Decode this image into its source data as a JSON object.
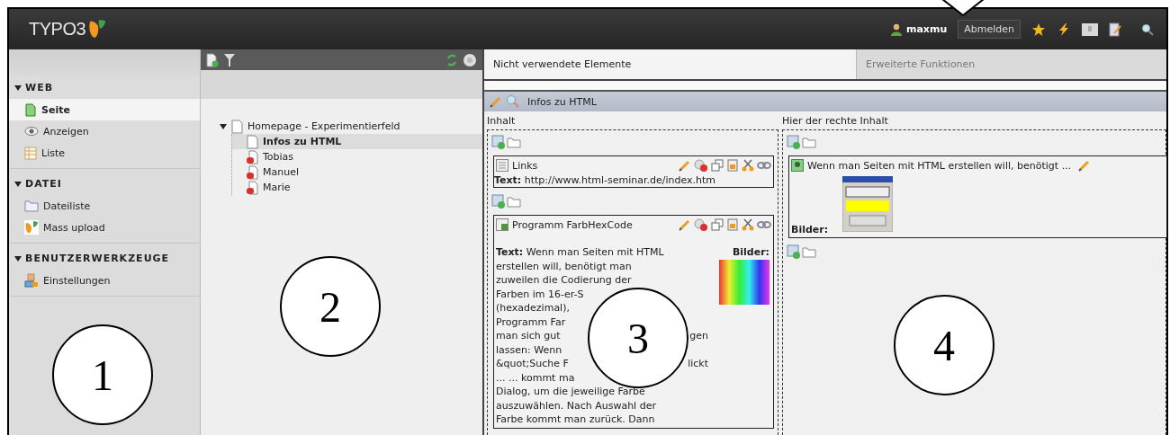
{
  "header": {
    "logo": "TYPO3",
    "user": "maxmu",
    "logout": "Abmelden"
  },
  "sidebar": {
    "groups": [
      {
        "title": "WEB",
        "expanded": true,
        "items": [
          {
            "label": "Seite",
            "kind": "page",
            "selected": true
          },
          {
            "label": "Anzeigen",
            "kind": "view",
            "selected": false
          },
          {
            "label": "Liste",
            "kind": "list",
            "selected": false
          }
        ]
      },
      {
        "title": "DATEI",
        "expanded": true,
        "items": [
          {
            "label": "Dateiliste",
            "kind": "files",
            "selected": false
          },
          {
            "label": "Mass upload",
            "kind": "logo",
            "selected": false
          }
        ]
      },
      {
        "title": "BENUTZERWERKZEUGE",
        "expanded": true,
        "items": [
          {
            "label": "Einstellungen",
            "kind": "settings",
            "selected": false
          }
        ]
      }
    ]
  },
  "page_tree": {
    "items": [
      {
        "label": "Homepage - Experimentierfeld",
        "kind": "page",
        "expanded": true,
        "selected": false,
        "children": [
          {
            "label": "Infos zu HTML",
            "kind": "page",
            "selected": true
          },
          {
            "label": "Tobias",
            "kind": "restricted",
            "selected": false
          },
          {
            "label": "Manuel",
            "kind": "restricted",
            "selected": false
          },
          {
            "label": "Marie",
            "kind": "restricted",
            "selected": false
          }
        ]
      }
    ]
  },
  "tabs": [
    {
      "label": "Nicht verwendete Elemente",
      "selected": true
    },
    {
      "label": "Erweiterte Funktionen",
      "selected": false
    }
  ],
  "page_header": {
    "title": "Infos zu HTML"
  },
  "columns": [
    {
      "heading": "Inhalt",
      "elements": [
        {
          "kind": "text",
          "title": "Links",
          "body": "**Text:** http://www.html-seminar.de/index.htm"
        },
        {
          "kind": "textpic",
          "title": "Programm FarbHexCode",
          "images_label": "Bilder:",
          "lines": [
            {
              "left": "**Text:** Wenn man Seiten mit HTML"
            },
            {
              "left": "erstellen will, benötigt man"
            },
            {
              "left": "zuweilen die Codierung der"
            },
            {
              "left": "Farben im 16-er-S"
            },
            {
              "left": "(hexadezimal),"
            },
            {
              "left": "Programm Far"
            },
            {
              "left": "man sich gut",
              "right": "gen"
            },
            {
              "left": "lassen: Wenn"
            },
            {
              "left": "&quot;Suche F",
              "right": "lickt"
            },
            {
              "left": "... ... kommt ma"
            },
            {
              "left": "Dialog, um die jeweilige Farbe"
            },
            {
              "left": "auszuwählen. Nach Auswahl der"
            },
            {
              "left": "Farbe kommt man zurück. Dann"
            }
          ]
        }
      ]
    },
    {
      "heading": "Hier der rechte Inhalt",
      "elements": [
        {
          "kind": "image",
          "title": "Wenn man Seiten mit HTML erstellen will, benötigt ...",
          "images_label": "Bilder:"
        }
      ]
    }
  ],
  "annotations": [
    {
      "label": "1"
    },
    {
      "label": "2"
    },
    {
      "label": "3"
    },
    {
      "label": "4"
    }
  ]
}
